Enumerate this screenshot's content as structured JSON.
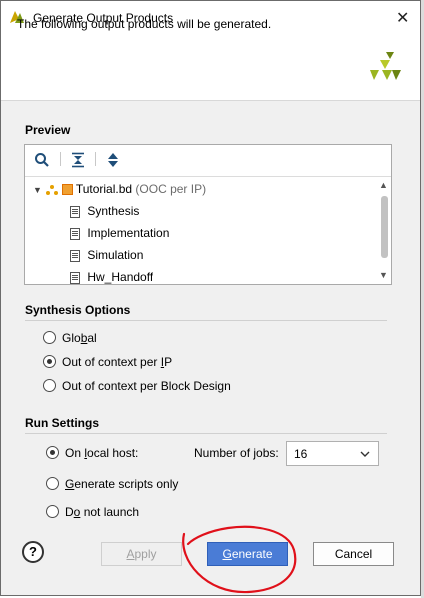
{
  "window": {
    "title": "Generate Output Products"
  },
  "header": {
    "text": "The following output products will be generated."
  },
  "preview": {
    "label": "Preview",
    "root": {
      "name": "Tutorial.bd",
      "suffix": "(OOC per IP)"
    },
    "children": [
      {
        "label": "Synthesis"
      },
      {
        "label": "Implementation"
      },
      {
        "label": "Simulation"
      },
      {
        "label": "Hw_Handoff"
      }
    ]
  },
  "synthesis_options": {
    "label": "Synthesis Options",
    "options": [
      {
        "pre": "Glo",
        "ul": "b",
        "post": "al",
        "selected": false
      },
      {
        "pre": "Out of context per ",
        "ul": "I",
        "post": "P",
        "selected": true
      },
      {
        "pre": "Out of context per Block Design",
        "ul": "",
        "post": "",
        "selected": false
      }
    ]
  },
  "run_settings": {
    "label": "Run Settings",
    "local_host": {
      "pre": "On ",
      "ul": "l",
      "post": "ocal host:",
      "selected": true
    },
    "jobs_label": "Number of jobs:",
    "jobs_value": "16",
    "scripts_only": {
      "pre": "",
      "ul": "G",
      "post": "enerate scripts only",
      "selected": false
    },
    "do_not_launch": {
      "pre": "D",
      "ul": "o",
      "post": " not launch",
      "selected": false
    }
  },
  "buttons": {
    "help": "?",
    "apply": {
      "pre": "",
      "ul": "A",
      "post": "pply"
    },
    "generate": {
      "pre": "",
      "ul": "G",
      "post": "enerate"
    },
    "cancel": "Cancel"
  },
  "colors": {
    "accent": "#4a7cd6",
    "annotation_circle": "#e0101a",
    "logo": "#9bb520"
  }
}
